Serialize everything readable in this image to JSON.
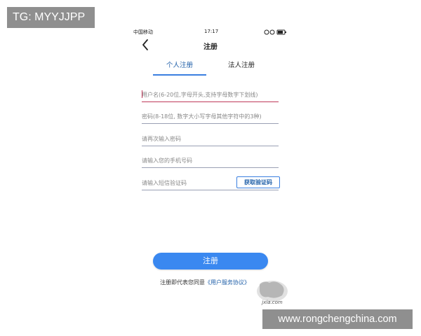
{
  "overlay": {
    "tg_label": "TG: MYYJJPP",
    "site_url": "www.rongchengchina.com",
    "logo_text": "jxia.com"
  },
  "status_bar": {
    "carrier": "中国移动",
    "time": "17:17"
  },
  "nav": {
    "back_icon": "chevron-left-icon",
    "title": "注册"
  },
  "tabs": [
    {
      "label": "个人注册",
      "active": true
    },
    {
      "label": "法人注册",
      "active": false
    }
  ],
  "form": {
    "username_placeholder": "用户名(6-20位,字母开头,支持字母数字下划线)",
    "password_placeholder": "密码(8-18位, 数字大小写字母其他字符中的3种)",
    "confirm_password_placeholder": "请再次输入密码",
    "phone_placeholder": "请输入您的手机号码",
    "sms_code_placeholder": "请输入短信验证码",
    "sms_button_label": "获取验证码"
  },
  "submit": {
    "label": "注册"
  },
  "agreement": {
    "prefix": "注册即代表您同意",
    "link": "《用户服务协议》"
  },
  "colors": {
    "accent": "#3a88f0",
    "active_field_line": "#c0395a",
    "badge_bg": "#8f8f8f"
  }
}
